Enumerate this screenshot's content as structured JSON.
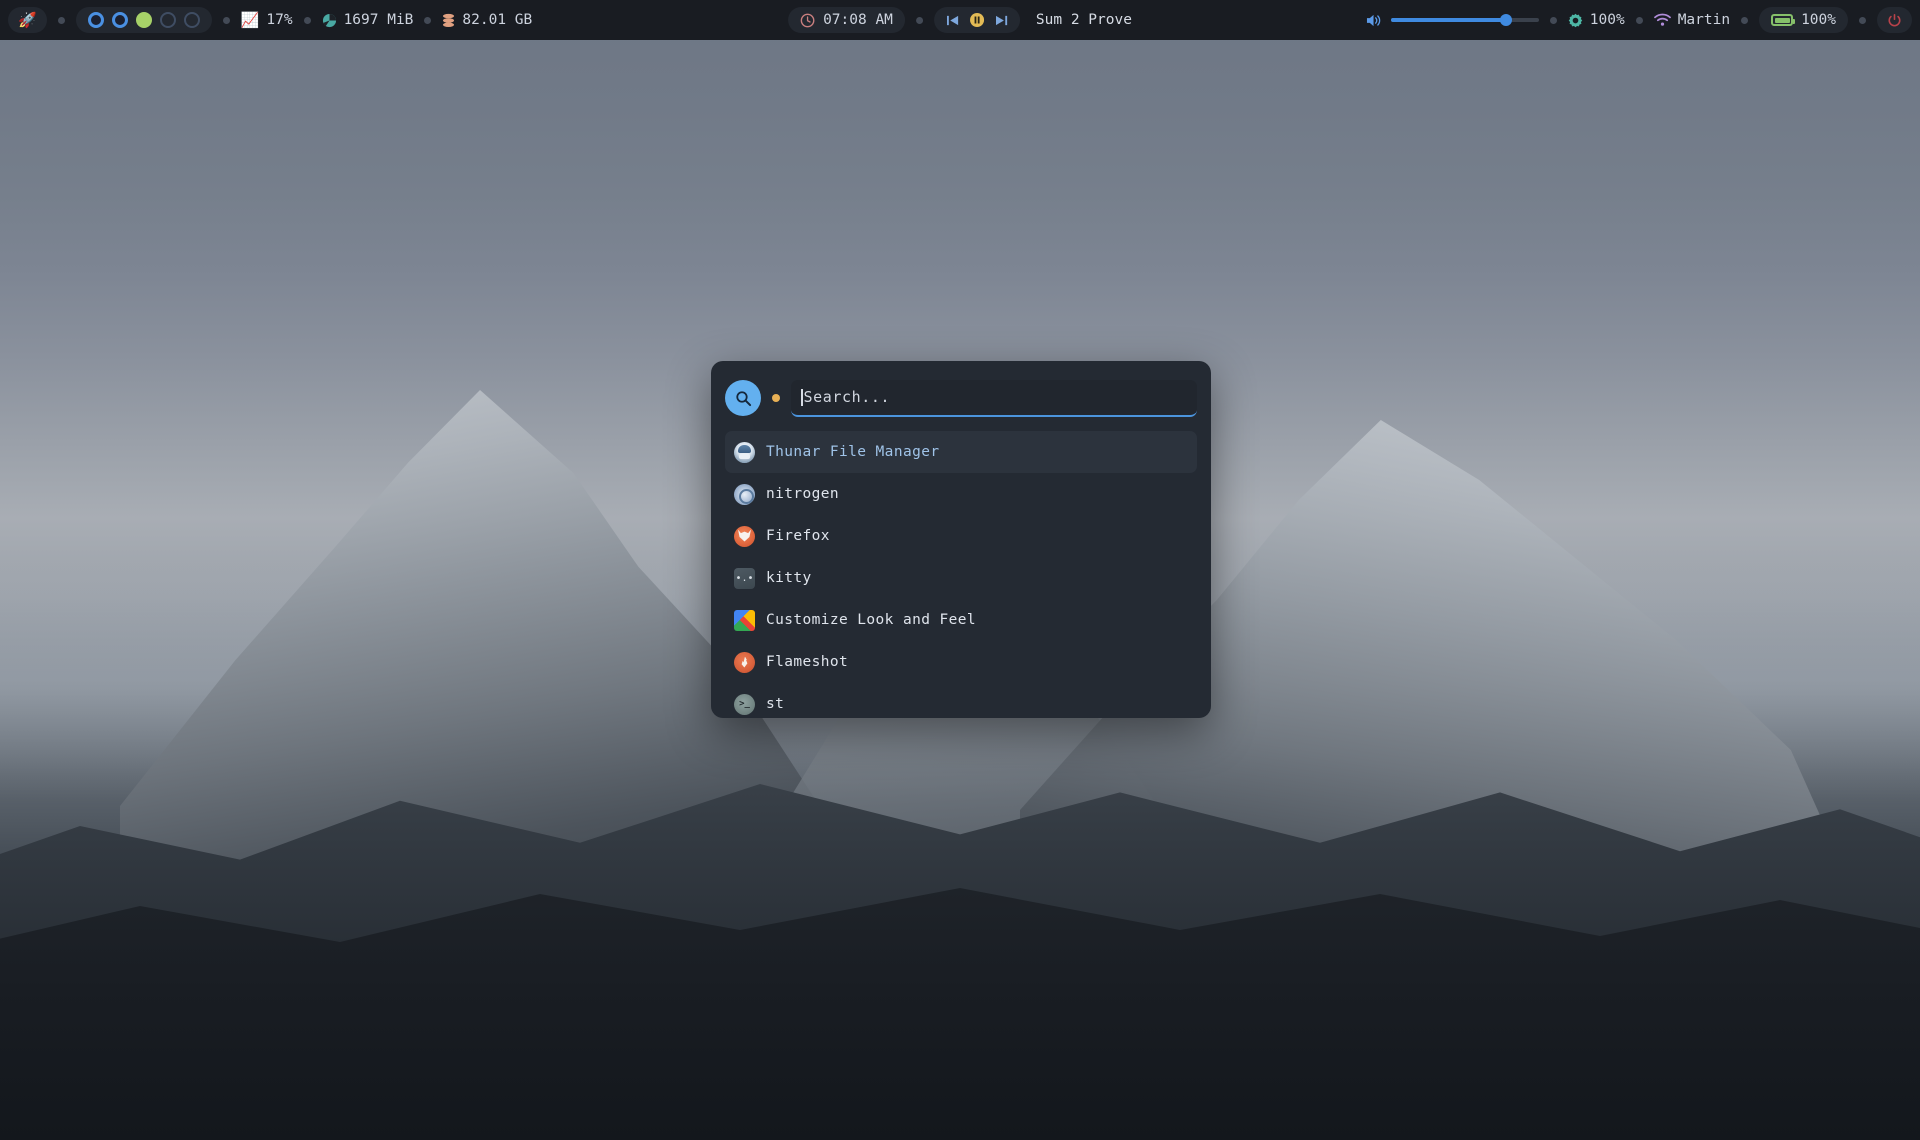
{
  "topbar": {
    "launcher_icon": "rocket-icon",
    "workspaces": [
      {
        "name": "workspace-1",
        "state": "occupied"
      },
      {
        "name": "workspace-2",
        "state": "occupied"
      },
      {
        "name": "workspace-3",
        "state": "active"
      },
      {
        "name": "workspace-4",
        "state": "empty"
      },
      {
        "name": "workspace-5",
        "state": "empty"
      }
    ],
    "cpu": {
      "icon": "chart-line-icon",
      "value": "17%"
    },
    "memory": {
      "icon": "pie-chart-icon",
      "value": "1697 MiB"
    },
    "disk": {
      "icon": "database-stack-icon",
      "value": "82.01 GB"
    },
    "clock": {
      "icon": "clock-icon",
      "value": "07:08 AM"
    },
    "media": {
      "prev_icon": "skip-previous-icon",
      "play_pause_icon": "pause-circle-icon",
      "next_icon": "skip-next-icon",
      "title": "Sum 2 Prove"
    },
    "volume": {
      "icon": "speaker-icon",
      "level_percent": 78
    },
    "brightness": {
      "icon": "gear-icon",
      "value": "100%"
    },
    "network": {
      "icon": "wifi-icon",
      "ssid": "Martin"
    },
    "battery": {
      "icon": "battery-icon",
      "value": "100%"
    },
    "power": {
      "icon": "power-icon"
    }
  },
  "launcher": {
    "search": {
      "button_icon": "search-icon",
      "indicator_icon": "mode-dot-icon",
      "placeholder": "Search...",
      "value": ""
    },
    "apps": [
      {
        "label": "Thunar File Manager",
        "icon": "thunar-icon",
        "selected": true
      },
      {
        "label": "nitrogen",
        "icon": "nitrogen-icon",
        "selected": false
      },
      {
        "label": "Firefox",
        "icon": "firefox-icon",
        "selected": false
      },
      {
        "label": "kitty",
        "icon": "kitty-icon",
        "selected": false
      },
      {
        "label": "Customize Look and Feel",
        "icon": "customize-icon",
        "selected": false
      },
      {
        "label": "Flameshot",
        "icon": "flameshot-icon",
        "selected": false
      },
      {
        "label": "st",
        "icon": "st-terminal-icon",
        "selected": false
      }
    ]
  },
  "colors": {
    "bar_bg": "#191c22",
    "pill_bg": "#232830",
    "launcher_bg": "#242a33",
    "selected_row_bg": "#2c333d",
    "accent_blue": "#63b0ef",
    "accent_orange": "#e8b055",
    "workspace_active": "#a6d168",
    "workspace_occupied": "#4a90e2",
    "power_red": "#b8424a",
    "battery_green": "#86c06a"
  }
}
